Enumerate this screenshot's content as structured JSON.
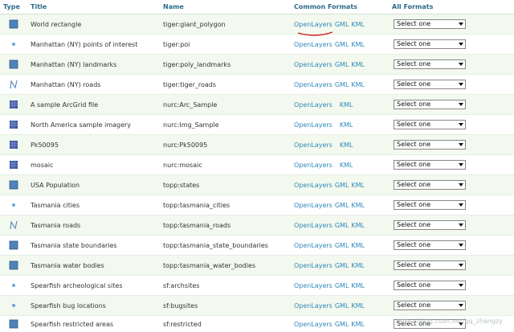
{
  "headers": {
    "type": "Type",
    "title": "Title",
    "name": "Name",
    "common": "Common Formats",
    "all": "All Formats"
  },
  "format_labels": {
    "openlayers": "OpenLayers",
    "gml": "GML",
    "kml": "KML"
  },
  "select_default": "Select one",
  "colors": {
    "header_text": "#2d6a8c",
    "link": "#2e88b8",
    "row_alt_bg": "#f3f9ef",
    "polygon_icon": "#4f82b8",
    "raster_icon": "#3a53a0",
    "annotation_red": "#d81b1b"
  },
  "rows": [
    {
      "icon": "polygon-icon",
      "title": "World rectangle",
      "name": "tiger:giant_polygon",
      "gml": true
    },
    {
      "icon": "point-icon",
      "title": "Manhattan (NY) points of interest",
      "name": "tiger:poi",
      "gml": true
    },
    {
      "icon": "polygon-icon",
      "title": "Manhattan (NY) landmarks",
      "name": "tiger:poly_landmarks",
      "gml": true
    },
    {
      "icon": "line-icon",
      "title": "Manhattan (NY) roads",
      "name": "tiger:tiger_roads",
      "gml": true
    },
    {
      "icon": "raster-icon",
      "title": "A sample ArcGrid file",
      "name": "nurc:Arc_Sample",
      "gml": false
    },
    {
      "icon": "raster-icon",
      "title": "North America sample imagery",
      "name": "nurc:Img_Sample",
      "gml": false
    },
    {
      "icon": "raster-icon",
      "title": "Pk50095",
      "name": "nurc:Pk50095",
      "gml": false
    },
    {
      "icon": "raster-icon",
      "title": "mosaic",
      "name": "nurc:mosaic",
      "gml": false
    },
    {
      "icon": "polygon-icon",
      "title": "USA Population",
      "name": "topp:states",
      "gml": true
    },
    {
      "icon": "point-icon",
      "title": "Tasmania cities",
      "name": "topp:tasmania_cities",
      "gml": true
    },
    {
      "icon": "line-icon",
      "title": "Tasmania roads",
      "name": "topp:tasmania_roads",
      "gml": true
    },
    {
      "icon": "polygon-icon",
      "title": "Tasmania state boundaries",
      "name": "topp:tasmania_state_boundaries",
      "gml": true
    },
    {
      "icon": "polygon-icon",
      "title": "Tasmania water bodies",
      "name": "topp:tasmania_water_bodies",
      "gml": true
    },
    {
      "icon": "point-icon",
      "title": "Spearfish archeological sites",
      "name": "sf:archsites",
      "gml": true
    },
    {
      "icon": "point-icon",
      "title": "Spearfish bug locations",
      "name": "sf:bugsites",
      "gml": true
    },
    {
      "icon": "polygon-icon",
      "title": "Spearfish restricted areas",
      "name": "sf:restricted",
      "gml": true
    }
  ],
  "watermark": "https://blog.csdn.net/qq_zhangzy"
}
